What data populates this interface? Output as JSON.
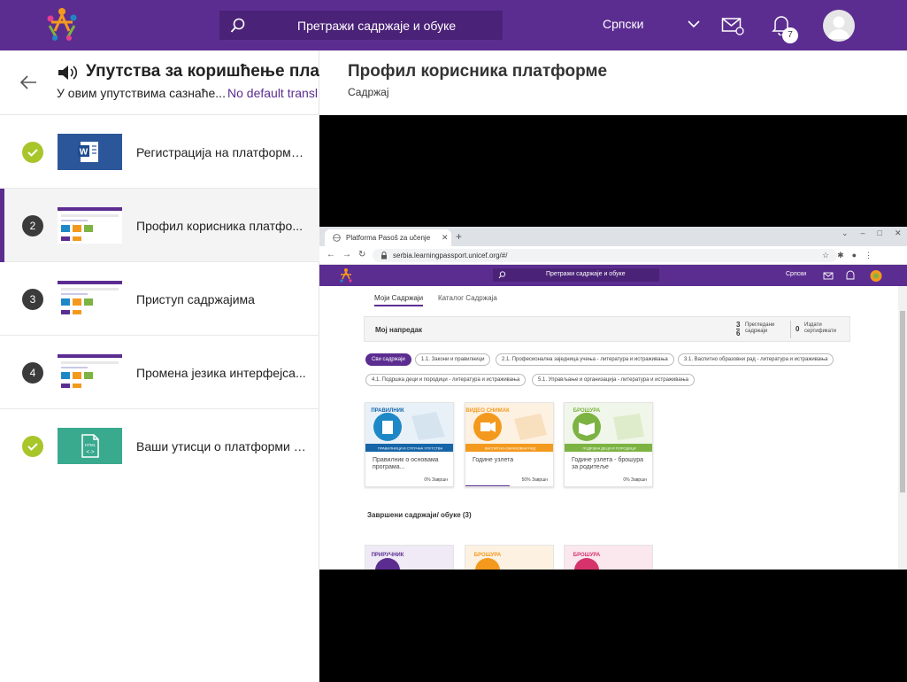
{
  "header": {
    "search_placeholder": "Претражи садржаје и обуке",
    "language": "Српски",
    "notifications_count": "7",
    "colors": {
      "brand": "#5c2d91"
    }
  },
  "course": {
    "title": "Упутства за коришћење пла",
    "description": "У овим упутствима сазнаће...",
    "translation_note": "No default transl",
    "items": [
      {
        "status": "done",
        "number": "",
        "thumb": "word",
        "label": "Регистрација на платформу..."
      },
      {
        "status": "active",
        "number": "2",
        "thumb": "screenshot",
        "label": "Профил корисника платфо..."
      },
      {
        "status": "todo",
        "number": "3",
        "thumb": "screenshot",
        "label": "Приступ садржајима"
      },
      {
        "status": "todo",
        "number": "4",
        "thumb": "screenshot",
        "label": "Промена језика интерфејса..."
      },
      {
        "status": "done",
        "number": "",
        "thumb": "html",
        "label": "Ваши утисци о платформи -..."
      }
    ]
  },
  "content": {
    "title": "Профил корисника платформе",
    "subtitle": "Садржај"
  },
  "screenshot": {
    "browser": {
      "tab_title": "Platforma Pasoš za učenje",
      "url": "serbia.learningpassport.unicef.org/#/"
    },
    "site": {
      "search_placeholder": "Претражи садржаје и обуке",
      "language": "Српски",
      "tab_my": "Моји Садржаји",
      "tab_catalog": "Каталог Садржаја",
      "progress_title": "Мој напредак",
      "viewed_count": "3",
      "viewed_total": "6",
      "viewed_label": "Прегледани садржаји",
      "certificates_count": "0",
      "certificates_label": "Издати сертификати",
      "chips": [
        "Сви садржаји",
        "1.1. Закони и правилници",
        "2.1. Професионална заједница учења - литература и истраживања",
        "3.1. Васпитно образовни рад - литература и истраживања",
        "4.1. Подршка деци и породици - литература и истраживања",
        "5.1. Управљање и организација - литература и истраживања"
      ],
      "cards": [
        {
          "badge": "ПРАВИЛНИК",
          "strip": "ПРАВИЛНИЦИ И СТРУЧНА УПУТСТВА",
          "title": "Правилник о основама програма...",
          "progress": "0% Завршн",
          "color": "#1e88c7",
          "strip_color": "#1565a8",
          "fill": 0
        },
        {
          "badge": "ВИДЕО СНИМАК",
          "strip": "ВАСПИТНО-ОБРАЗОВНИ РАД",
          "title": "Године узлета",
          "progress": "50% Завршн",
          "color": "#f39a1e",
          "strip_color": "#f39a1e",
          "fill": 0.5
        },
        {
          "badge": "БРОШУРА",
          "strip": "ПОДРШКА ДЕЦИ И ПОРОДИЦИ",
          "title": "Године узлета - брошура за родитеље",
          "progress": "0% Завршн",
          "color": "#7cb342",
          "strip_color": "#7cb342",
          "fill": 0
        }
      ],
      "completed_heading": "Завршени садржаји/ обуке (3)",
      "completed_cards": [
        {
          "badge": "ПРИРУЧНИК",
          "color": "#5c2d91"
        },
        {
          "badge": "БРОШУРА",
          "color": "#f39a1e"
        },
        {
          "badge": "БРОШУРА",
          "color": "#d6336c"
        }
      ]
    }
  }
}
